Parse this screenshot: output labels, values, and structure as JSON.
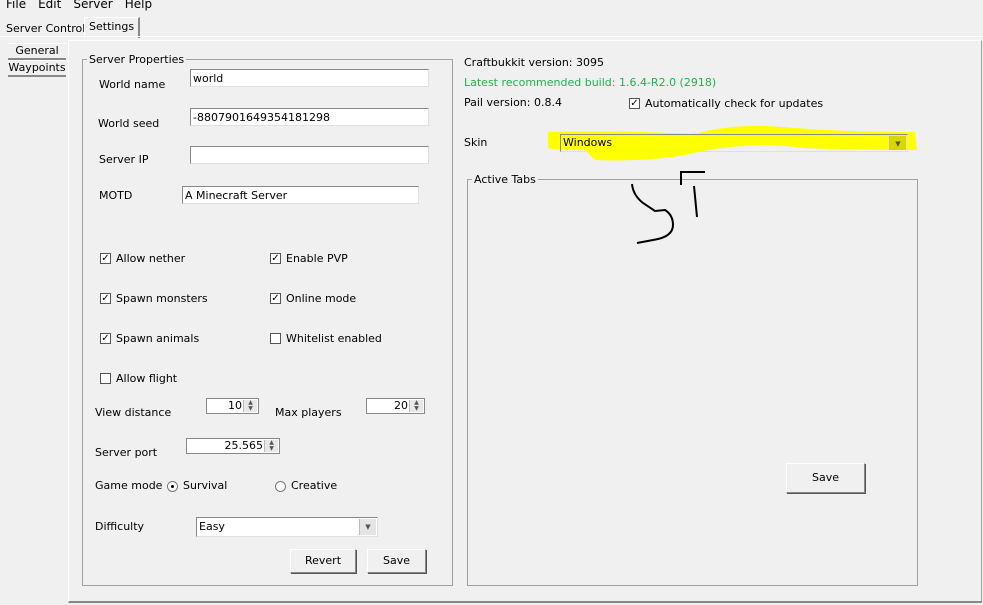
{
  "menu": [
    "File",
    "Edit",
    "Server",
    "Help"
  ],
  "tabs": [
    "Server Control",
    "Settings"
  ],
  "side_tabs": [
    "General",
    "Waypoints"
  ],
  "server_properties": {
    "legend": "Server Properties",
    "world_name_label": "World name",
    "world_name": "world",
    "world_seed_label": "World seed",
    "world_seed": "-8807901649354181298",
    "server_ip_label": "Server IP",
    "server_ip": "",
    "motd_label": "MOTD",
    "motd": "A Minecraft Server",
    "checkboxes": [
      {
        "label": "Allow nether",
        "checked": true
      },
      {
        "label": "Enable PVP",
        "checked": true
      },
      {
        "label": "Spawn monsters",
        "checked": true
      },
      {
        "label": "Online mode",
        "checked": true
      },
      {
        "label": "Spawn animals",
        "checked": true
      },
      {
        "label": "Whitelist enabled",
        "checked": false
      },
      {
        "label": "Allow flight",
        "checked": false
      }
    ],
    "view_distance_label": "View distance",
    "view_distance": "10",
    "max_players_label": "Max players",
    "max_players": "20",
    "server_port_label": "Server port",
    "server_port": "25.565",
    "game_mode_label": "Game mode",
    "game_modes": [
      "Survival",
      "Creative"
    ],
    "game_mode_selected": "Survival",
    "difficulty_label": "Difficulty",
    "difficulty": "Easy",
    "revert_label": "Revert",
    "save_label": "Save"
  },
  "info": {
    "craftbukkit": "Craftbukkit version: 3095",
    "latest": "Latest recommended build: 1.6.4-R2.0 (2918)",
    "latest_color": "#22b14c",
    "pail": "Pail version: 0.8.4",
    "auto_update_label": "Automatically check for updates",
    "auto_update": true,
    "skin_label": "Skin",
    "skin": "Windows",
    "active_tabs_legend": "Active Tabs",
    "save_label": "Save"
  },
  "annotation": {
    "highlight_color": "#ffff00"
  }
}
